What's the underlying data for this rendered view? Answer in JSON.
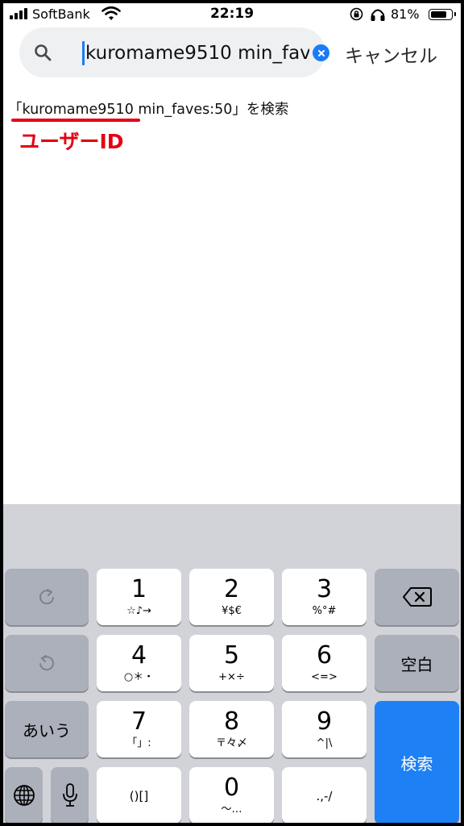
{
  "status_bar": {
    "carrier": "SoftBank",
    "time": "22:19",
    "battery_percent": "81%",
    "battery_level": 0.81
  },
  "search": {
    "value": "kuromame9510 min_faves:50",
    "cancel_label": "キャンセル"
  },
  "suggestion": {
    "text": "「kuromame9510 min_faves:50」を検索"
  },
  "annotation": {
    "label": "ユーザーID",
    "color": "#e50012"
  },
  "keyboard": {
    "keys": [
      {
        "num": "1",
        "sub": "☆♪→"
      },
      {
        "num": "2",
        "sub": "¥$€"
      },
      {
        "num": "3",
        "sub": "%°#"
      },
      {
        "num": "4",
        "sub": "○＊・"
      },
      {
        "num": "5",
        "sub": "+×÷"
      },
      {
        "num": "6",
        "sub": "<=>"
      },
      {
        "num": "7",
        "sub": "「」:"
      },
      {
        "num": "8",
        "sub": "〒々〆"
      },
      {
        "num": "9",
        "sub": "^|\\"
      },
      {
        "num": "",
        "sub": "()[]"
      },
      {
        "num": "0",
        "sub": "〜…"
      },
      {
        "num": "",
        "sub": ".,-/"
      }
    ],
    "space_label": "空白",
    "hiragana_label": "あいう",
    "search_label": "検索",
    "accent_color": "#1d80f5"
  }
}
